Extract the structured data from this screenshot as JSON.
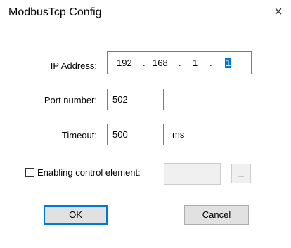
{
  "window": {
    "title": "ModbusTcp Config",
    "close_glyph": "×"
  },
  "ip": {
    "label": "IP Address:",
    "octets": [
      "192",
      "168",
      "1",
      "1"
    ],
    "separator": "."
  },
  "port": {
    "label": "Port number:",
    "value": "502"
  },
  "timeout": {
    "label": "Timeout:",
    "value": "500",
    "unit": "ms"
  },
  "control": {
    "label": "Enabling control element:",
    "checked": false,
    "value": "",
    "browse_label": "..."
  },
  "buttons": {
    "ok": "OK",
    "cancel": "Cancel"
  },
  "colors": {
    "selection": "#0078d7",
    "button_face": "#e1e1e1",
    "disabled_face": "#f0f0f0"
  }
}
